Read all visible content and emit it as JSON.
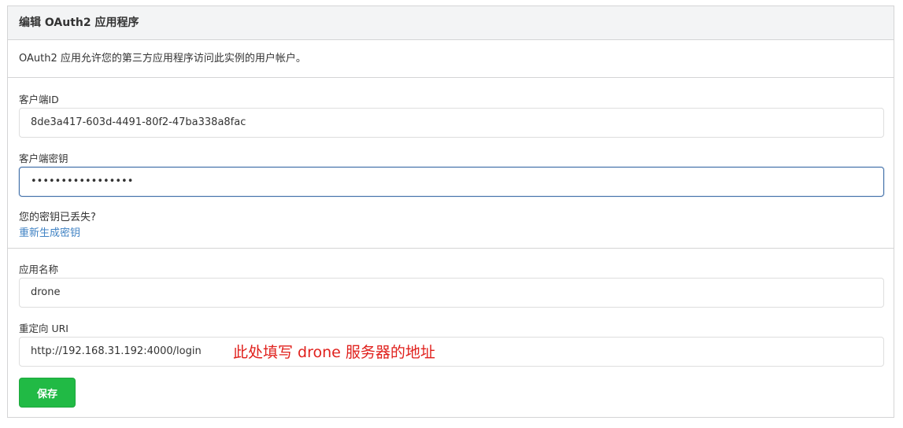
{
  "header": {
    "title": "编辑 OAuth2 应用程序"
  },
  "description": "OAuth2 应用允许您的第三方应用程序访问此实例的用户帐户。",
  "client_id": {
    "label": "客户端ID",
    "value": "8de3a417-603d-4491-80f2-47ba338a8fac"
  },
  "client_secret": {
    "label": "客户端密钥",
    "masked_value": "•••••••••••••••••"
  },
  "secret_lost": {
    "question": "您的密钥已丢失?",
    "regenerate_link": "重新生成密钥"
  },
  "app_name": {
    "label": "应用名称",
    "value": "drone"
  },
  "redirect_uri": {
    "label": "重定向 URI",
    "value": "http://192.168.31.192:4000/login"
  },
  "annotation": {
    "text": "此处填写 drone 服务器的地址",
    "color": "#e0201c"
  },
  "save_button": {
    "label": "保存",
    "color": "#21ba45"
  }
}
